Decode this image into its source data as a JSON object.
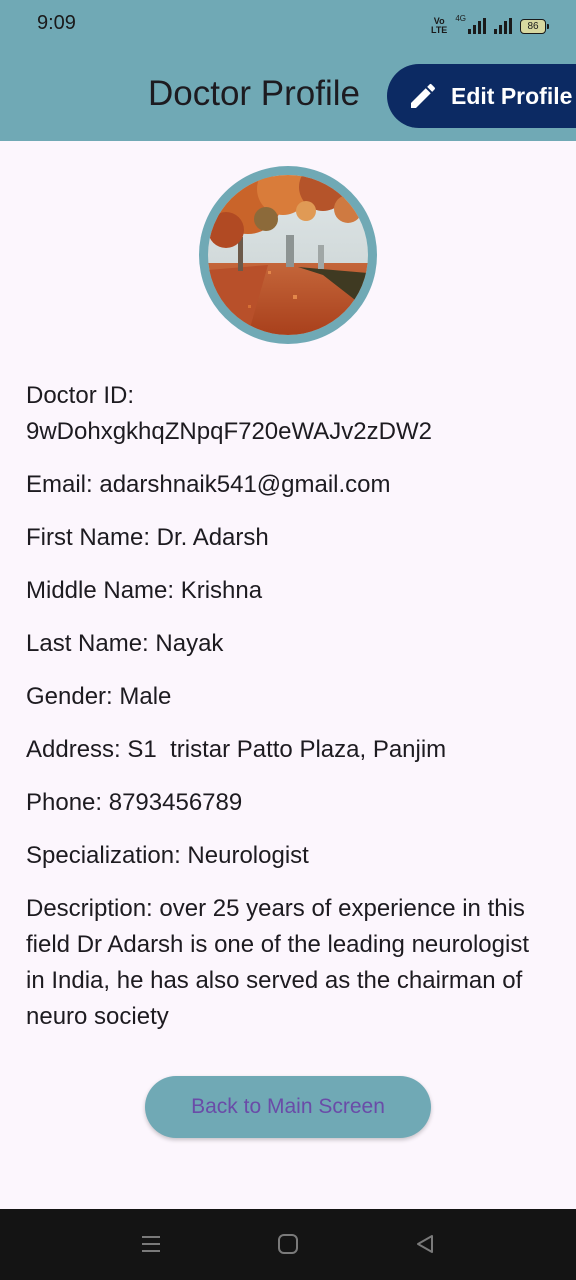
{
  "status_bar": {
    "time": "9:09",
    "network": "4G",
    "volte": "Vo LTE",
    "battery": "86"
  },
  "app_bar": {
    "title": "Doctor Profile",
    "edit_label": "Edit Profile"
  },
  "profile": {
    "doctor_id_line1": "Doctor ID:",
    "doctor_id_line2": "9wDohxgkhqZNpqF720eWAJv2zDW2",
    "email": "Email: adarshnaik541@gmail.com",
    "first_name": "First Name: Dr. Adarsh",
    "middle_name": "Middle Name: Krishna",
    "last_name": "Last Name: Nayak",
    "gender": "Gender: Male",
    "address": "Address: S1  tristar Patto Plaza, Panjim",
    "phone": "Phone: 8793456789",
    "specialization": "Specialization: Neurologist",
    "description": "Description: over 25 years of experience in this field Dr Adarsh is one of the leading neurologist in India, he has also served as the chairman of neuro society"
  },
  "actions": {
    "back_label": "Back to Main Screen"
  },
  "colors": {
    "accent": "#70a9b5",
    "edit_button": "#0c2a63",
    "background": "#fcf6fd",
    "back_text": "#6a4ca8"
  },
  "icons": {
    "edit": "pencil-icon",
    "nav": [
      "menu-icon",
      "home-icon",
      "back-icon"
    ]
  }
}
